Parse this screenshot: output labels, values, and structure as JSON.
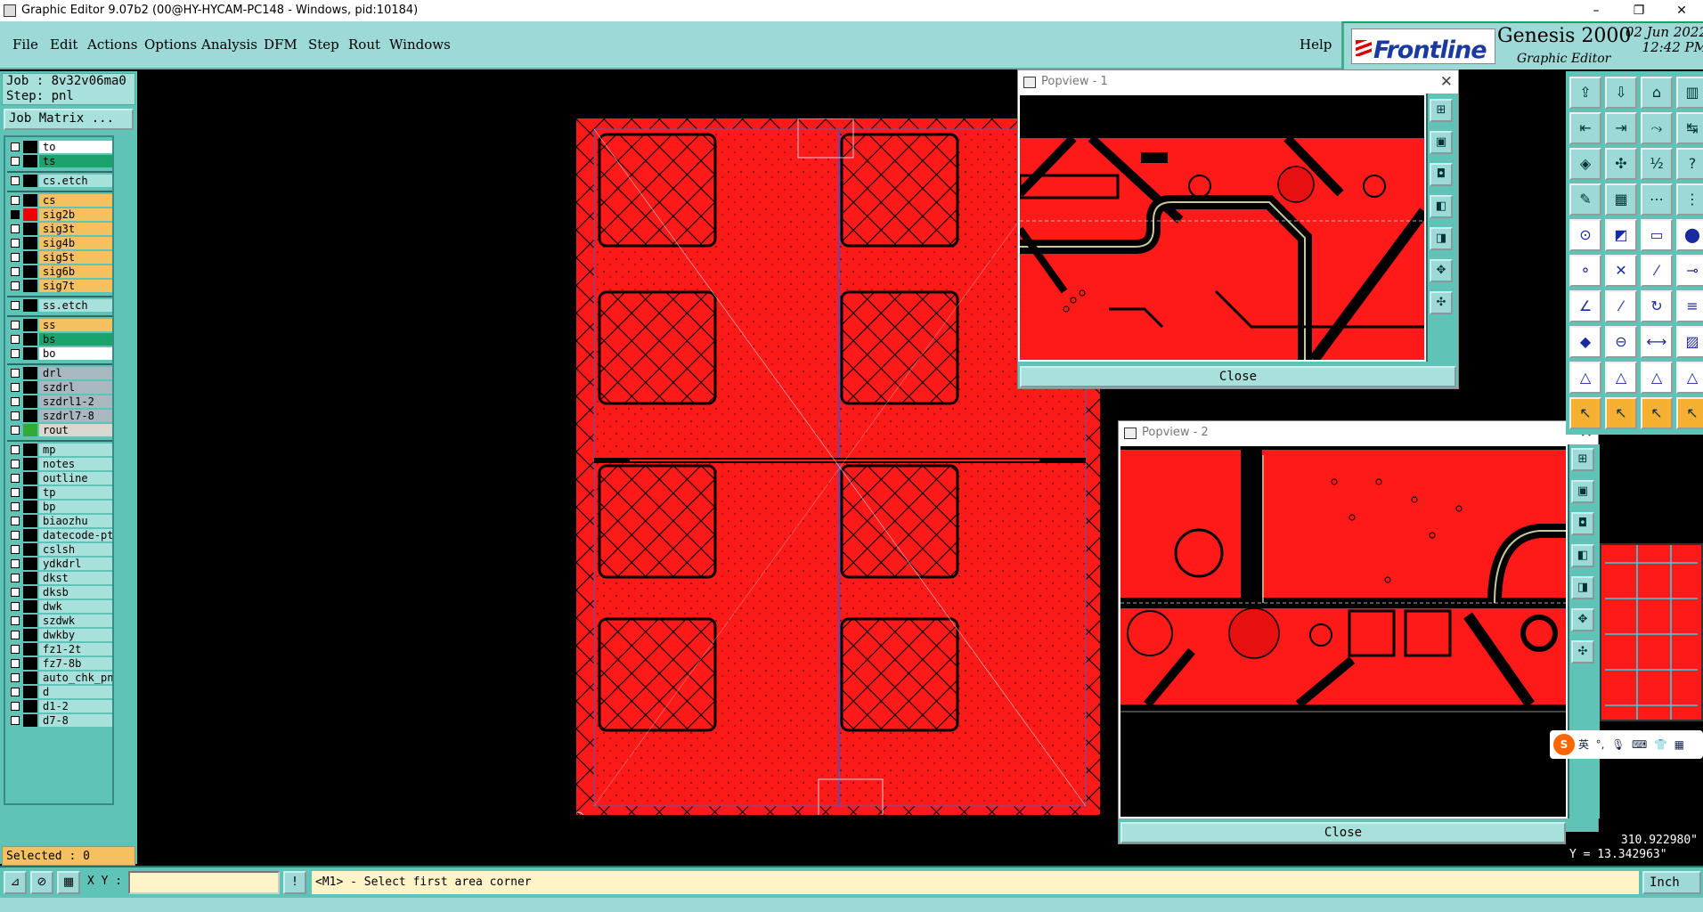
{
  "window": {
    "title": "Graphic Editor 9.07b2 (00@HY-HYCAM-PC148 - Windows, pid:10184)",
    "minimize": "–",
    "restore": "❐",
    "close": "✕"
  },
  "menu": [
    "File",
    "Edit",
    "Actions",
    "Options",
    "Analysis",
    "DFM",
    "Step",
    "Rout",
    "Windows"
  ],
  "help": "Help",
  "logo": {
    "brand": "Frontline",
    "product": "Genesis 2000",
    "subtitle": "Graphic Editor",
    "date": "02 Jun 2022",
    "time": "12:42 PM"
  },
  "job": {
    "job_line": "Job : 8v32v06ma0",
    "step_line": "Step: pnl",
    "job_matrix": "Job Matrix ..."
  },
  "layers": [
    {
      "name": "to",
      "color": "#ffffff",
      "active": false
    },
    {
      "name": "ts",
      "color": "#1aa36b",
      "active": false
    },
    {
      "name": "cs.etch",
      "color": "#a8e0dc",
      "active": false
    },
    {
      "name": "cs",
      "color": "#f5c060",
      "active": false
    },
    {
      "name": "sig2b",
      "color": "#f5c060",
      "active": true
    },
    {
      "name": "sig3t",
      "color": "#f5c060",
      "active": false
    },
    {
      "name": "sig4b",
      "color": "#f5c060",
      "active": false
    },
    {
      "name": "sig5t",
      "color": "#f5c060",
      "active": false
    },
    {
      "name": "sig6b",
      "color": "#f5c060",
      "active": false
    },
    {
      "name": "sig7t",
      "color": "#f5c060",
      "active": false
    },
    {
      "name": "ss.etch",
      "color": "#a8e0dc",
      "active": false
    },
    {
      "name": "ss",
      "color": "#f5c060",
      "active": false
    },
    {
      "name": "bs",
      "color": "#1aa36b",
      "active": false
    },
    {
      "name": "bo",
      "color": "#ffffff",
      "active": false
    },
    {
      "name": "drl",
      "color": "#a9b8c0",
      "active": false
    },
    {
      "name": "szdrl",
      "color": "#a9b8c0",
      "active": false
    },
    {
      "name": "szdrl1-2",
      "color": "#a9b8c0",
      "active": false
    },
    {
      "name": "szdrl7-8",
      "color": "#a9b8c0",
      "active": false
    },
    {
      "name": "rout",
      "color": "#d8d8d0",
      "active": false
    },
    {
      "name": "mp",
      "color": "#a8e0dc",
      "active": false
    },
    {
      "name": "notes",
      "color": "#a8e0dc",
      "active": false
    },
    {
      "name": "outline",
      "color": "#a8e0dc",
      "active": false
    },
    {
      "name": "tp",
      "color": "#a8e0dc",
      "active": false
    },
    {
      "name": "bp",
      "color": "#a8e0dc",
      "active": false
    },
    {
      "name": "biaozhu",
      "color": "#a8e0dc",
      "active": false
    },
    {
      "name": "datecode-pth",
      "color": "#a8e0dc",
      "active": false
    },
    {
      "name": "cslsh",
      "color": "#a8e0dc",
      "active": false
    },
    {
      "name": "ydkdrl",
      "color": "#a8e0dc",
      "active": false
    },
    {
      "name": "dkst",
      "color": "#a8e0dc",
      "active": false
    },
    {
      "name": "dksb",
      "color": "#a8e0dc",
      "active": false
    },
    {
      "name": "dwk",
      "color": "#a8e0dc",
      "active": false
    },
    {
      "name": "szdwk",
      "color": "#a8e0dc",
      "active": false
    },
    {
      "name": "dwkby",
      "color": "#a8e0dc",
      "active": false
    },
    {
      "name": "fz1-2t",
      "color": "#a8e0dc",
      "active": false
    },
    {
      "name": "fz7-8b",
      "color": "#a8e0dc",
      "active": false
    },
    {
      "name": "auto_chk_pnl",
      "color": "#a8e0dc",
      "active": false
    },
    {
      "name": "d",
      "color": "#a8e0dc",
      "active": false
    },
    {
      "name": "d1-2",
      "color": "#a8e0dc",
      "active": false
    },
    {
      "name": "d7-8",
      "color": "#a8e0dc",
      "active": false
    }
  ],
  "selected": "Selected : 0",
  "popview1": {
    "title": "Popview - 1",
    "close": "Close"
  },
  "popview2": {
    "title": "Popview - 2",
    "close": "Close"
  },
  "coords": {
    "x": "310.922980\"",
    "y": "Y = 13.342963\""
  },
  "status": {
    "xy_label": "X Y :",
    "xy_value": "",
    "message": "<M1> - Select first area corner",
    "unit": "Inch"
  },
  "ime": {
    "logo": "S",
    "lang": "英"
  },
  "colors": {
    "copper": "#ff1a1a",
    "panel": "#5fc3b8",
    "menu": "#9dd9d6"
  }
}
